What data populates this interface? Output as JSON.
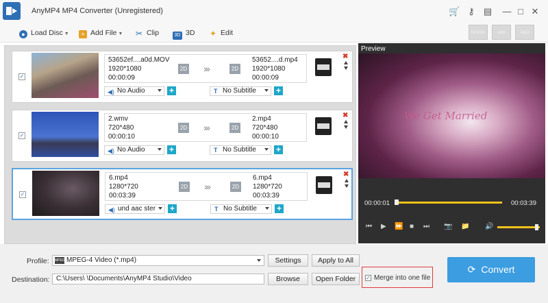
{
  "window": {
    "title": "AnyMP4 MP4 Converter (Unregistered)"
  },
  "toolbar": {
    "load_disc": "Load Disc",
    "add_file": "Add File",
    "clip": "Clip",
    "three_d": "3D",
    "edit": "Edit",
    "hw_nvidia": "NVIDIA",
    "hw_intel": "intel",
    "hw_amd": "AMD"
  },
  "files": [
    {
      "source_name": "53652ef....a0d.MOV",
      "source_res": "1920*1080",
      "source_dur": "00:00:09",
      "src_badge": "2D",
      "out_name": "53652....d.mp4",
      "out_res": "1920*1080",
      "out_dur": "00:00:09",
      "out_badge": "2D",
      "audio": "No Audio",
      "subtitle": "No Subtitle"
    },
    {
      "source_name": "2.wmv",
      "source_res": "720*480",
      "source_dur": "00:00:10",
      "src_badge": "2D",
      "out_name": "2.mp4",
      "out_res": "720*480",
      "out_dur": "00:00:10",
      "out_badge": "2D",
      "audio": "No Audio",
      "subtitle": "No Subtitle"
    },
    {
      "source_name": "6.mp4",
      "source_res": "1280*720",
      "source_dur": "00:03:39",
      "src_badge": "2D",
      "out_name": "6.mp4",
      "out_res": "1280*720",
      "out_dur": "00:03:39",
      "out_badge": "2D",
      "audio": "und aac ster",
      "subtitle": "No Subtitle"
    }
  ],
  "preview": {
    "label": "Preview",
    "overlay_text": "We Get Married",
    "current_time": "00:00:01",
    "total_time": "00:03:39",
    "progress": 0.01,
    "volume": 0.85
  },
  "bottom": {
    "profile_label": "Profile:",
    "profile_value": "MPEG-4 Video (*.mp4)",
    "settings": "Settings",
    "apply_to_all": "Apply to All",
    "destination_label": "Destination:",
    "destination_value": "C:\\Users\\        \\Documents\\AnyMP4 Studio\\Video",
    "browse": "Browse",
    "open_folder": "Open Folder",
    "merge_label": "Merge into one file",
    "convert": "Convert"
  },
  "colors": {
    "accent": "#3c9de0",
    "progress": "#f4c21a",
    "highlight": "#e03a3a"
  }
}
